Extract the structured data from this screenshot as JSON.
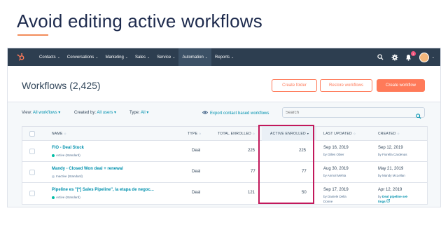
{
  "slide": {
    "title": "Avoid editing active workflows"
  },
  "nav": {
    "items": [
      {
        "label": "Contacts",
        "active": false
      },
      {
        "label": "Conversations",
        "active": false
      },
      {
        "label": "Marketing",
        "active": false
      },
      {
        "label": "Sales",
        "active": false
      },
      {
        "label": "Service",
        "active": false
      },
      {
        "label": "Automation",
        "active": true
      },
      {
        "label": "Reports",
        "active": false
      }
    ],
    "chevron": "⌄",
    "notification_count": "1",
    "avatar_chevron": "⌄"
  },
  "header": {
    "title": "Workflows (2,425)",
    "create_folder_label": "Create folder",
    "restore_label": "Restore workflows",
    "create_workflow_label": "Create workflow"
  },
  "filters": {
    "view_label": "View:",
    "view_value": "All workflows ▾",
    "created_by_label": "Created by:",
    "created_by_value": "All users ▾",
    "type_label": "Type:",
    "type_value": "All ▾",
    "export_label": "Export contact based workflows",
    "search_placeholder": "Search"
  },
  "table": {
    "columns": {
      "name": "NAME",
      "type": "TYPE",
      "total_enrolled": "TOTAL ENROLLED",
      "active_enrolled": "ACTIVE ENROLLED",
      "last_updated": "LAST UPDATED",
      "created": "CREATED"
    },
    "sort_glyph": "⬦",
    "active_sort_glyph": "▾",
    "rows": [
      {
        "name": "FIO - Deal Stuck",
        "status": "Active (Standard)",
        "type": "Deal",
        "total_enrolled": "225",
        "active_enrolled": "225",
        "last_updated_date": "Sep 16, 2019",
        "last_updated_by": "by Gilles Obier",
        "created_date": "Sep 12, 2019",
        "created_by": "by Fiorella Cardenas",
        "created_link": ""
      },
      {
        "name": "Mandy - Closed Won deal + renewal",
        "status": "Inactive (Standard)",
        "type": "Deal",
        "total_enrolled": "77",
        "active_enrolled": "77",
        "last_updated_date": "Aug 30, 2019",
        "last_updated_by": "by Anmol Mehta",
        "created_date": "May 21, 2019",
        "created_by": "by Mandy McLellan",
        "created_link": ""
      },
      {
        "name": "Pipeline es \"[*] Sales Pipeline\", la etapa de negoc...",
        "status": "Active (Standard)",
        "type": "Deal",
        "total_enrolled": "121",
        "active_enrolled": "50",
        "last_updated_date": "Sep 17, 2019",
        "last_updated_by": "by Daniele Della",
        "last_updated_by2": "Donne",
        "created_date": "Apr 12, 2019",
        "created_by": "by ",
        "created_link": "Deal pipeline set-",
        "created_link2": "tings"
      }
    ]
  },
  "colors": {
    "nav_bg": "#2d3e50",
    "accent": "#ff7a59",
    "link": "#0091ae",
    "active_dot": "#00bda5",
    "inactive_dot": "#cbd6e2",
    "highlight": "#c2185b"
  }
}
